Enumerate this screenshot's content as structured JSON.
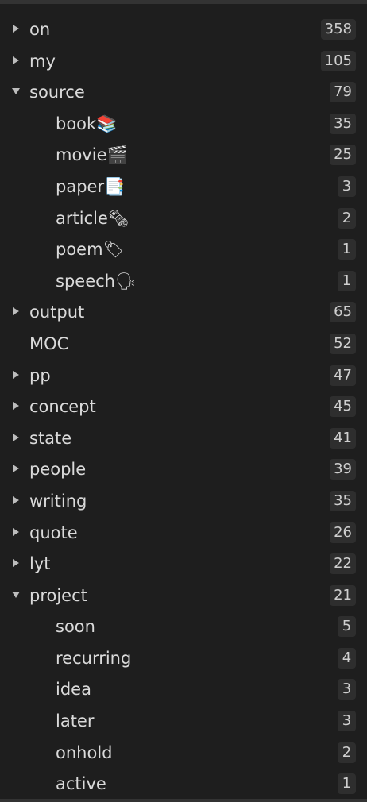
{
  "tags": [
    {
      "label": "on",
      "count": "358",
      "level": 0,
      "arrow": "collapsed"
    },
    {
      "label": "my",
      "count": "105",
      "level": 0,
      "arrow": "collapsed"
    },
    {
      "label": "source",
      "count": "79",
      "level": 0,
      "arrow": "expanded"
    },
    {
      "label": "book📚",
      "count": "35",
      "level": 1,
      "arrow": "none"
    },
    {
      "label": "movie🎬",
      "count": "25",
      "level": 1,
      "arrow": "none"
    },
    {
      "label": "paper📑",
      "count": "3",
      "level": 1,
      "arrow": "none"
    },
    {
      "label": "article🗞",
      "count": "2",
      "level": 1,
      "arrow": "none"
    },
    {
      "label": "poem🏷",
      "count": "1",
      "level": 1,
      "arrow": "none"
    },
    {
      "label": "speech🗣",
      "count": "1",
      "level": 1,
      "arrow": "none"
    },
    {
      "label": "output",
      "count": "65",
      "level": 0,
      "arrow": "collapsed"
    },
    {
      "label": "MOC",
      "count": "52",
      "level": 0,
      "arrow": "none"
    },
    {
      "label": "pp",
      "count": "47",
      "level": 0,
      "arrow": "collapsed"
    },
    {
      "label": "concept",
      "count": "45",
      "level": 0,
      "arrow": "collapsed"
    },
    {
      "label": "state",
      "count": "41",
      "level": 0,
      "arrow": "collapsed"
    },
    {
      "label": "people",
      "count": "39",
      "level": 0,
      "arrow": "collapsed"
    },
    {
      "label": "writing",
      "count": "35",
      "level": 0,
      "arrow": "collapsed"
    },
    {
      "label": "quote",
      "count": "26",
      "level": 0,
      "arrow": "collapsed"
    },
    {
      "label": "lyt",
      "count": "22",
      "level": 0,
      "arrow": "collapsed"
    },
    {
      "label": "project",
      "count": "21",
      "level": 0,
      "arrow": "expanded"
    },
    {
      "label": "soon",
      "count": "5",
      "level": 1,
      "arrow": "none"
    },
    {
      "label": "recurring",
      "count": "4",
      "level": 1,
      "arrow": "none"
    },
    {
      "label": "idea",
      "count": "3",
      "level": 1,
      "arrow": "none"
    },
    {
      "label": "later",
      "count": "3",
      "level": 1,
      "arrow": "none"
    },
    {
      "label": "onhold",
      "count": "2",
      "level": 1,
      "arrow": "none"
    },
    {
      "label": "active",
      "count": "1",
      "level": 1,
      "arrow": "none"
    }
  ],
  "colors": {
    "background": "#1e1e1e",
    "text": "#dadada",
    "badge_bg": "#2e2e2e",
    "arrow": "#bdbdbd"
  },
  "icons": {
    "collapsed": "triangle-right-icon",
    "expanded": "triangle-down-icon"
  }
}
